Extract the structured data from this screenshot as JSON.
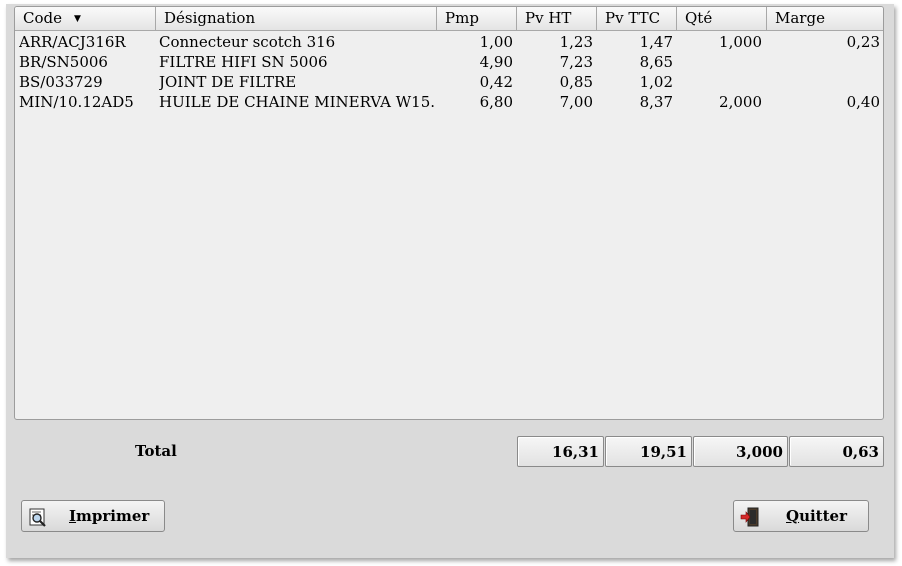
{
  "table": {
    "columns": [
      "Code",
      "Désignation",
      "Pmp",
      "Pv HT",
      "Pv TTC",
      "Qté",
      "Marge"
    ],
    "sort_column": "Code",
    "rows": [
      {
        "code": "ARR/ACJ316R",
        "designation": "Connecteur scotch 316",
        "pmp": "1,00",
        "pvht": "1,23",
        "pvttc": "1,47",
        "qte": "1,000",
        "marge": "0,23"
      },
      {
        "code": "BR/SN5006",
        "designation": "FILTRE HIFI SN 5006",
        "pmp": "4,90",
        "pvht": "7,23",
        "pvttc": "8,65",
        "qte": "",
        "marge": ""
      },
      {
        "code": "BS/033729",
        "designation": "JOINT DE FILTRE",
        "pmp": "0,42",
        "pvht": "0,85",
        "pvttc": "1,02",
        "qte": "",
        "marge": ""
      },
      {
        "code": "MIN/10.12AD5",
        "designation": "HUILE DE CHAINE MINERVA W15...",
        "pmp": "6,80",
        "pvht": "7,00",
        "pvttc": "8,37",
        "qte": "2,000",
        "marge": "0,40"
      }
    ]
  },
  "totals": {
    "label": "Total",
    "pvht": "16,31",
    "pvttc": "19,51",
    "qte": "3,000",
    "marge": "0,63"
  },
  "buttons": {
    "print_prefix": "I",
    "print_rest": "mprimer",
    "quit_prefix": "Q",
    "quit_rest": "uitter",
    "print_icon": "print-preview-icon",
    "quit_icon": "exit-door-icon"
  }
}
